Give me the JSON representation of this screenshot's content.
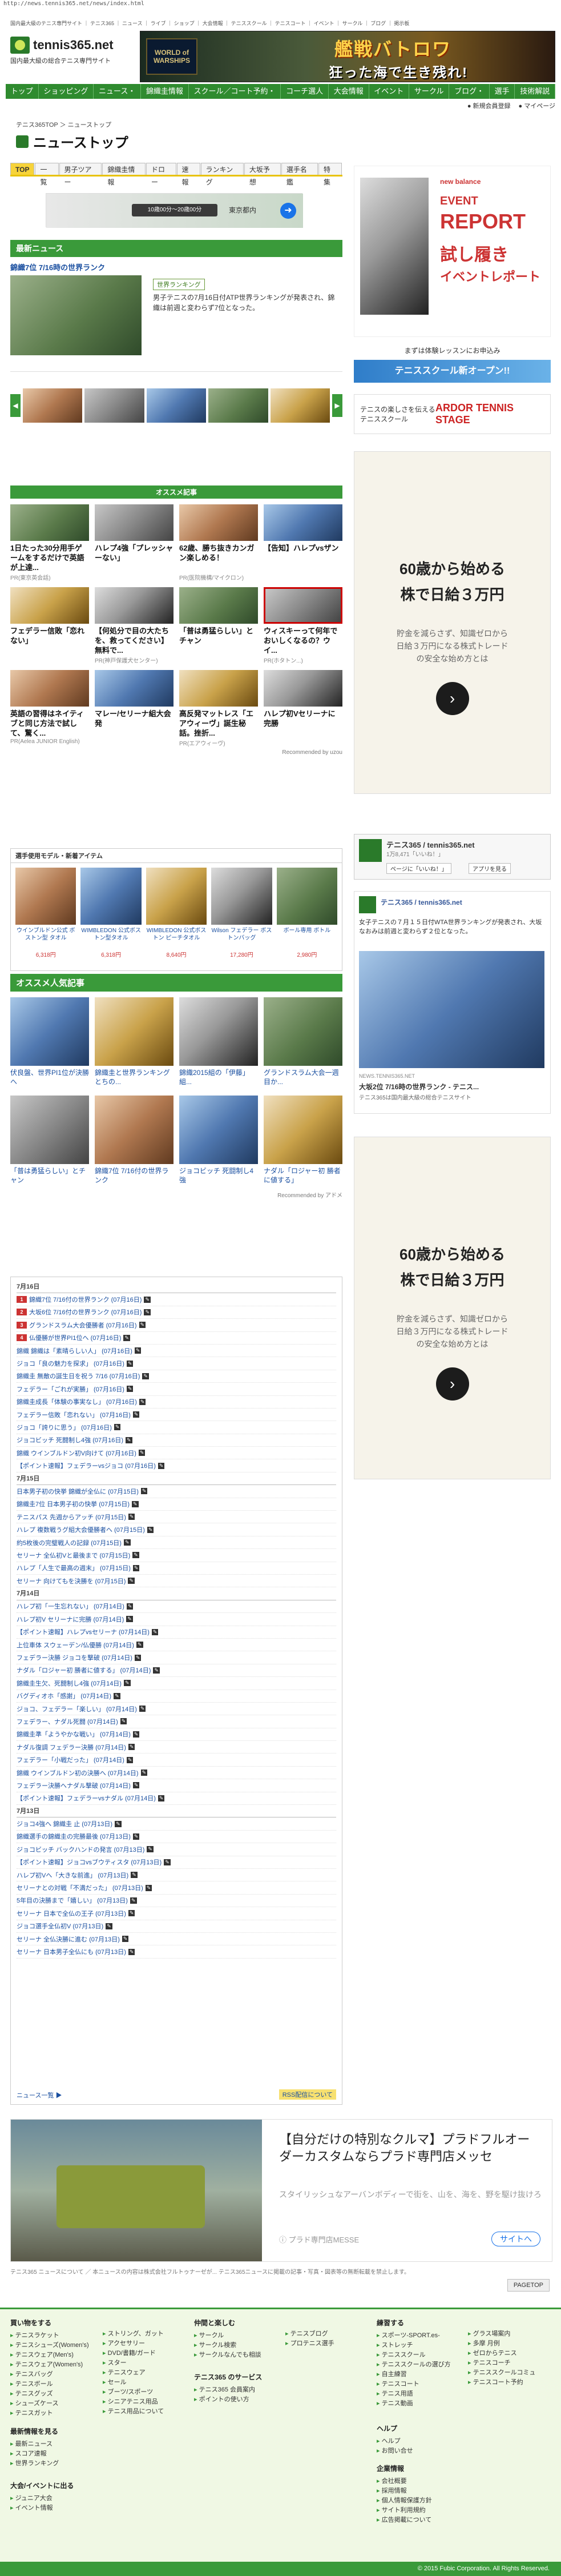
{
  "url": "http://news.tennis365.net/news/index.html",
  "header": {
    "topline": "国内最大級のテニス専門サイト ｜ テニス365 ｜ ニュース ｜ ライブ ｜ ショップ ｜ 大会情報 ｜ テニススクール ｜ テニスコート ｜ イベント ｜ サークル ｜ ブログ ｜ 掲示板",
    "logo_text": "tennis365.net",
    "logo_sub": "国内最大級の総合テニス専門サイト",
    "ad_brand": "WORLD of WARSHIPS",
    "ad_title": "艦戦バトロワ",
    "ad_tagline": "狂った海で生き残れ!"
  },
  "nav": [
    "トップ",
    "ショッピング",
    "ニュース・",
    "錦織圭情報",
    "スクール／コート予約・",
    "コーチ選人",
    "大会情報",
    "イベント",
    "サークル",
    "ブログ・",
    "選手",
    "技術解説"
  ],
  "subnav": {
    "new_msg": "新規会員登録",
    "mypage": "マイページ"
  },
  "breadcrumb": "テニス365TOP ＞ ニューストップ",
  "page_title": "ニューストップ",
  "tabs": [
    "TOP",
    "一覧",
    "男子ツアー",
    "錦織圭情報",
    "ドロー",
    "速報",
    "ランキング",
    "大坂予想",
    "選手名鑑",
    "特集"
  ],
  "search_ad": {
    "rate": "10歳00分〜20歳00分",
    "place": "東京都内"
  },
  "latest": {
    "heading": "最新ニュース",
    "headline": "錦織7位 7/16時の世界ランク",
    "tag": "世界ランキング",
    "summary": "男子テニスの7月16日付ATP世界ランキングが発表され、錦織は前週と変わらず7位となった。"
  },
  "recommend": {
    "heading": "オススメ記事",
    "items": [
      {
        "title": "1日たった30分用手ゲームをするだけで英語が上達...",
        "source": "PR(東京英会話)"
      },
      {
        "title": "ハレプ4強「プレッシャーない」",
        "source": ""
      },
      {
        "title": "62歳、勝ち抜きカンガン楽しめる！",
        "source": "PR(医院機構/マイクロン)"
      },
      {
        "title": "【告知】ハレプvsザン",
        "source": ""
      },
      {
        "title": "フェデラー信敗「恋れない」",
        "source": ""
      },
      {
        "title": "【何処分で目の大たちを、救ってください】無料で...",
        "source": "PR(神戸保護犬センター)"
      },
      {
        "title": "「普は勇猛らしい」とチャン",
        "source": ""
      },
      {
        "title": "ウィスキーって何年でおいしくなるの？ウイ...",
        "source": "PR(ホタトン...)"
      },
      {
        "title": "英語の習得はネイティブと同じ方法で試して、驚く...",
        "source": "PR(Aelea JUNIOR English)"
      },
      {
        "title": "マレー/セリーナ組大会発",
        "source": ""
      },
      {
        "title": "高反発マットレス「エアウィーヴ」誕生秘話。挫折...",
        "source": "PR(エアウィーヴ)"
      },
      {
        "title": "ハレプ初Vセリーナに完勝",
        "source": ""
      }
    ],
    "powered": "Recommended by uzou"
  },
  "goods": {
    "heading": "選手使用モデル・新着アイテム",
    "items": [
      {
        "name": "ウインブルドン公式 ボストン型 タオル",
        "price": "6,318円"
      },
      {
        "name": "WIMBLEDON 公式ボストン型タオル",
        "price": "6,318円"
      },
      {
        "name": "WIMBLEDON 公式ボストン ピーチタオル",
        "price": "8,640円"
      },
      {
        "name": "Wilson フェデラー ボストンバッグ",
        "price": "17,280円"
      },
      {
        "name": "ボール専用 ボトル",
        "price": "2,980円"
      }
    ]
  },
  "popular": {
    "heading": "オススメ人気記事",
    "items": [
      "伏良盤、世界PI1位が決勝へ",
      "錦織圭と世界ランキングとちの...",
      "錦織2015組の「伊藤」組...",
      "グランドスラム大会一週目か...",
      "「普は勇猛らしい」とチャン",
      "錦織7位 7/16付の世界ランク",
      "ジョコビッチ 死闘制し4強",
      "ナダル「ロジャー初 勝者に値する」"
    ],
    "powered": "Recommended by アドメ"
  },
  "ranking": {
    "groups": [
      {
        "date": "7月16日",
        "rows": [
          "錦織7位 7/16付の世界ランク (07月16日)",
          "大坂6位 7/16付の世界ランク (07月16日)",
          "グランドスラム大会優勝者 (07月16日)",
          "仏優勝が世界PI1位へ (07月16日)",
          "錦織 錦織は「素晴らしい人」 (07月16日)",
          "ジョコ「良の魅力を探求」 (07月16日)",
          "錦織圭 無敵の誕生日を祝う 7/16 (07月16日)",
          "フェデラー「ごれが実勝」 (07月16日)",
          "錦織圭成長「体験の事実なし」 (07月16日)",
          "フェデラー信敗「恋れない」 (07月16日)",
          "ジョコ「誇りに思う」 (07月16日)",
          "ジョコビッチ 死闘制し4強 (07月16日)",
          "錦織 ウインブルドン初V向けて (07月16日)",
          "【ポイント速報】フェデラーvsジョコ (07月16日)"
        ]
      },
      {
        "date": "7月15日",
        "rows": [
          "日本男子初の快挙 錦織が全仏に (07月15日)",
          "錦織圭7位 日本男子初の快挙 (07月15日)",
          "テニスパス 先週からアッチ (07月15日)",
          "ハレプ 複数戦うグ組大会優勝者へ (07月15日)",
          "約5枚後の完璧戦人の記録 (07月15日)",
          "セリーナ 全仏初Vと最後まで (07月15日)",
          "ハレプ「人生で最高の週末」 (07月15日)",
          "セリーナ 向けてもを決勝を (07月15日)"
        ]
      },
      {
        "date": "7月14日",
        "rows": [
          "ハレプ初「一生忘れない」 (07月14日)",
          "ハレプ初V セリーナに完勝 (07月14日)",
          "【ポイント速報】ハレプvsセリーナ (07月14日)",
          "上位車体 スウェーデン/仏優勝 (07月14日)",
          "フェデラー決勝 ジョコを撃破 (07月14日)",
          "ナダル「ロジャー初 勝者に値する」 (07月14日)",
          "錦織圭生欠、死闘制し4強 (07月14日)",
          "バグディオホ「感謝」 (07月14日)",
          "ジョコ、フェデラー「楽しい」 (07月14日)",
          "フェデラー、ナダル死闘 (07月14日)",
          "錦織圭準「ようやかな戦い」 (07月14日)",
          "ナダル復調 フェデラー決勝 (07月14日)",
          "フェデラー「小戦だった」 (07月14日)",
          "錦織 ウインブルドン初の決勝へ (07月14日)",
          "フェデラー決勝へナダル撃破 (07月14日)",
          "【ポイント速報】フェデラーvsナダル (07月14日)"
        ]
      },
      {
        "date": "7月13日",
        "rows": [
          "ジョコ4強へ 錦織圭 止 (07月13日)",
          "錦織選手の錦織圭の完勝最後 (07月13日)",
          "ジョコビッチ バックハンドの発言 (07月13日)",
          "【ポイント速報】ジョコvsブウティスタ (07月13日)",
          "ハレプ初Vへ「大きな前進」 (07月13日)",
          "セリーナとの対戦「不満だった」 (07月13日)",
          "5年目の決勝まで「嬉しい」 (07月13日)",
          "セリーナ 日本で全仏の王子 (07月13日)",
          "ジョコ選手全仏初V (07月13日)",
          "セリーナ 全仏決勝に進む (07月13日)",
          "セリーナ 日本男子全仏にも (07月13日)"
        ]
      }
    ],
    "more_link": "ニュース一覧 ▶",
    "rss": "RSS配信について"
  },
  "sidebar": {
    "event_ad": {
      "brand": "new balance",
      "line1": "EVENT",
      "line2": "REPORT",
      "line3": "試し履き",
      "line4": "イベントレポート"
    },
    "lesson_banner": "まずは体験レッスンにお申込み",
    "school_banner_1": "テニススクール新オープン!!",
    "school_banner_2": "テニスの楽しさを伝えるテニススクール",
    "ardor": "ARDOR TENNIS STAGE",
    "stock_ad": {
      "l1": "60歳から始める",
      "l2": "株で日給３万円",
      "l3": "貯金を減らさず、知識ゼロから日給３万円になる株式トレードの安全な始め方とは"
    },
    "fb_page": {
      "name": "テニス365 / tennis365.net",
      "likes": "1万8,471「いいね！」",
      "like_btn": "ページに「いいね！」",
      "app_btn": "アプリを見る"
    },
    "fb_post": {
      "name": "テニス365 / tennis365.net",
      "text": "女子テニスの７月１５日付WTA世界ランキングが発表され、大坂なおみは前週と変わらず２位となった。",
      "caption": "NEWS.TENNIS365.NET",
      "title": "大坂2位 7/16時の世界ランク - テニス...",
      "desc": "テニス365は国内最大級の総合テニスサイト"
    },
    "stock_ad2": {
      "l1": "60歳から始める",
      "l2": "株で日給３万円",
      "l3": "貯金を減らさず、知識ゼロから日給３万円になる株式トレードの安全な始め方とは"
    }
  },
  "car_ad": {
    "title": "【自分だけの特別なクルマ】プラドフルオーダーカスタムならプラド専門店メッセ",
    "desc": "スタイリッシュなアーバンボディーで街を、山を、海を、野を駆け抜けろ",
    "sponsor": "プラド専門店MESSE",
    "link": "サイトへ"
  },
  "disclaimer": "テニス365 ニュースについて ／ 本ニュースの内容は株式会社フルトゥナーゼが... テニス365ニュースに掲載の記事・写真・図表等の無断転載を禁止します。",
  "pagetop": "PAGETOP",
  "footer": {
    "cols": [
      {
        "heading": "買い物をする",
        "items": [
          "テニスラケット",
          "テニスシューズ(Women's)",
          "テニスウェア(Men's)",
          "テニスウェア(Women's)",
          "テニスバッグ",
          "テニスボール",
          "テニスグッズ",
          "シューズケース",
          "テニスガット"
        ]
      },
      {
        "heading": "",
        "items": [
          "ストリング、ガット",
          "アクセサリー",
          "DVD/書籍/ガード",
          "スター",
          "テニスウェア",
          "セール",
          "ブーツ/スポーツ",
          "シニアテニス用品",
          "テニス用品について"
        ]
      },
      {
        "heading": "仲間と楽しむ",
        "items": [
          "サークル",
          "サークル検索",
          "サークルなんでも相談"
        ]
      },
      {
        "heading": "",
        "items": [
          "テニスブログ",
          "プロテニス選手"
        ]
      },
      {
        "heading": "練習する",
        "items": [
          "スポーツ-SPORT.es-",
          "ストレッチ",
          "テニススクール",
          "テニススクールの選び方",
          "自主練習",
          "テニスコート",
          "テニス用語",
          "テニス動画"
        ]
      },
      {
        "heading": "",
        "items": [
          "グラス場案内",
          "多摩 月例",
          "ゼロからテニス",
          "テニスコーチ",
          "テニススクールコミュ",
          "テニスコート予約"
        ]
      }
    ],
    "news_heading": "最新情報を見る",
    "news_items": [
      "最新ニュース",
      "スコア速報",
      "世界ランキング"
    ],
    "event_heading": "大会/イベントに出る",
    "event_items": [
      "ジュニア大会",
      "イベント情報"
    ],
    "service_heading": "テニス365 のサービス",
    "service_items": [
      "テニス365 会員案内",
      "ポイントの使い方"
    ],
    "help_heading": "ヘルプ",
    "help_items": [
      "ヘルプ",
      "お問い合せ"
    ],
    "company_heading": "企業情報",
    "company_items": [
      "会社概要",
      "採用情報",
      "個人情報保護方針",
      "サイト利用規約",
      "広告掲載について"
    ],
    "copyright": "© 2015 Fubic Corporation. All Rights Reserved."
  }
}
